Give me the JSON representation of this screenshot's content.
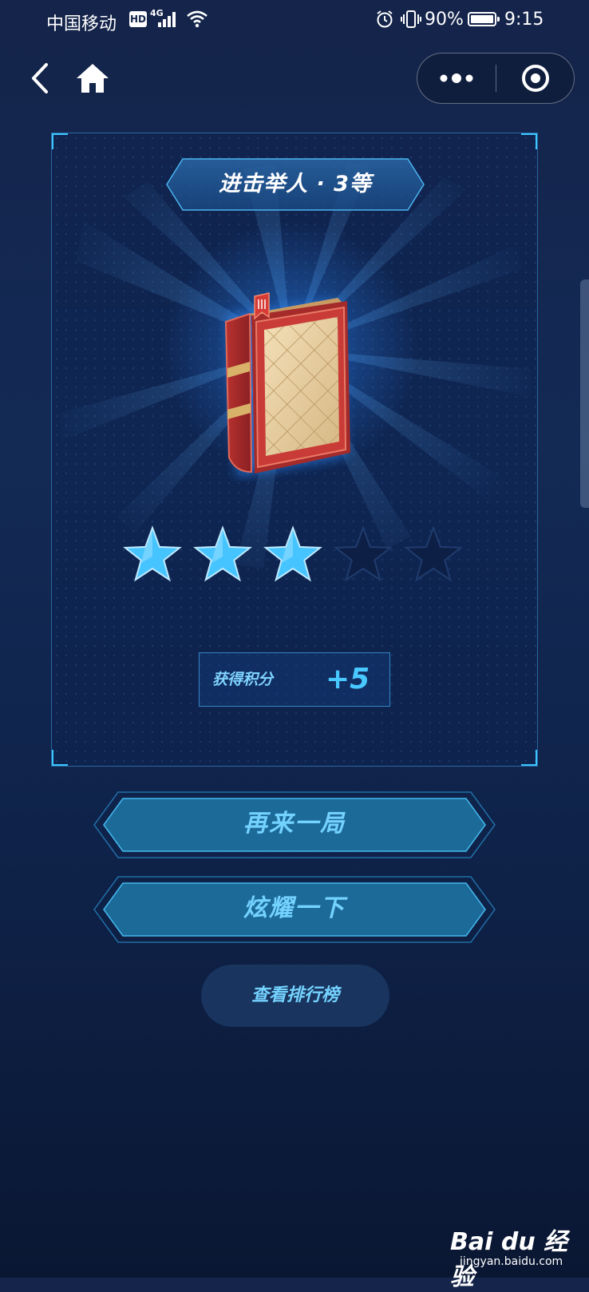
{
  "status_bar": {
    "carrier": "中国移动",
    "hd_badge": "HD",
    "network": "4G",
    "battery": "90%",
    "time": "9:15"
  },
  "nav": {
    "back_icon": "chevron-left-icon",
    "home_icon": "home-icon",
    "more_icon": "more-dots-icon",
    "close_icon": "target-circle-icon"
  },
  "result": {
    "title": "进击举人 · 3等",
    "badge_icon": "book-icon",
    "rating": 3,
    "rating_max": 5,
    "score_label": "获得积分",
    "score_value": "+5"
  },
  "actions": {
    "play_again": "再来一局",
    "share": "炫耀一下",
    "leaderboard": "查看排行榜"
  },
  "watermark": {
    "logo": "Bai du 经验",
    "site": "jingyan.baidu.com"
  },
  "colors": {
    "accent": "#49c8ff",
    "background": "#132a55",
    "star_filled": "#46c4ff",
    "star_empty": "#0d1f45"
  }
}
